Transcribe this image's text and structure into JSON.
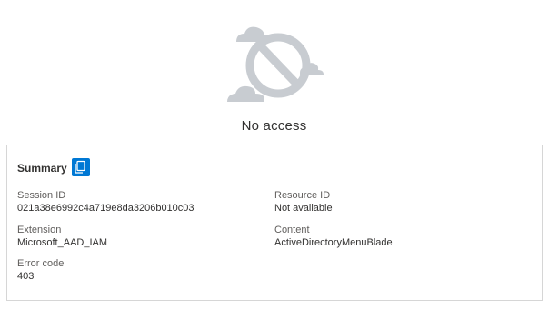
{
  "status": {
    "icon": "blocked-cloud-icon",
    "headline": "No access"
  },
  "summary": {
    "title": "Summary",
    "copy_icon": "copy-icon",
    "fields": {
      "session_id": {
        "label": "Session ID",
        "value": "021a38e6992c4a719e8da3206b010c03"
      },
      "resource_id": {
        "label": "Resource ID",
        "value": "Not available"
      },
      "extension": {
        "label": "Extension",
        "value": "Microsoft_AAD_IAM"
      },
      "content": {
        "label": "Content",
        "value": "ActiveDirectoryMenuBlade"
      },
      "error_code": {
        "label": "Error code",
        "value": "403"
      }
    }
  },
  "colors": {
    "accent": "#0078d4",
    "illustration_gray": "#c8ccd1",
    "border": "#d6d6d6"
  }
}
